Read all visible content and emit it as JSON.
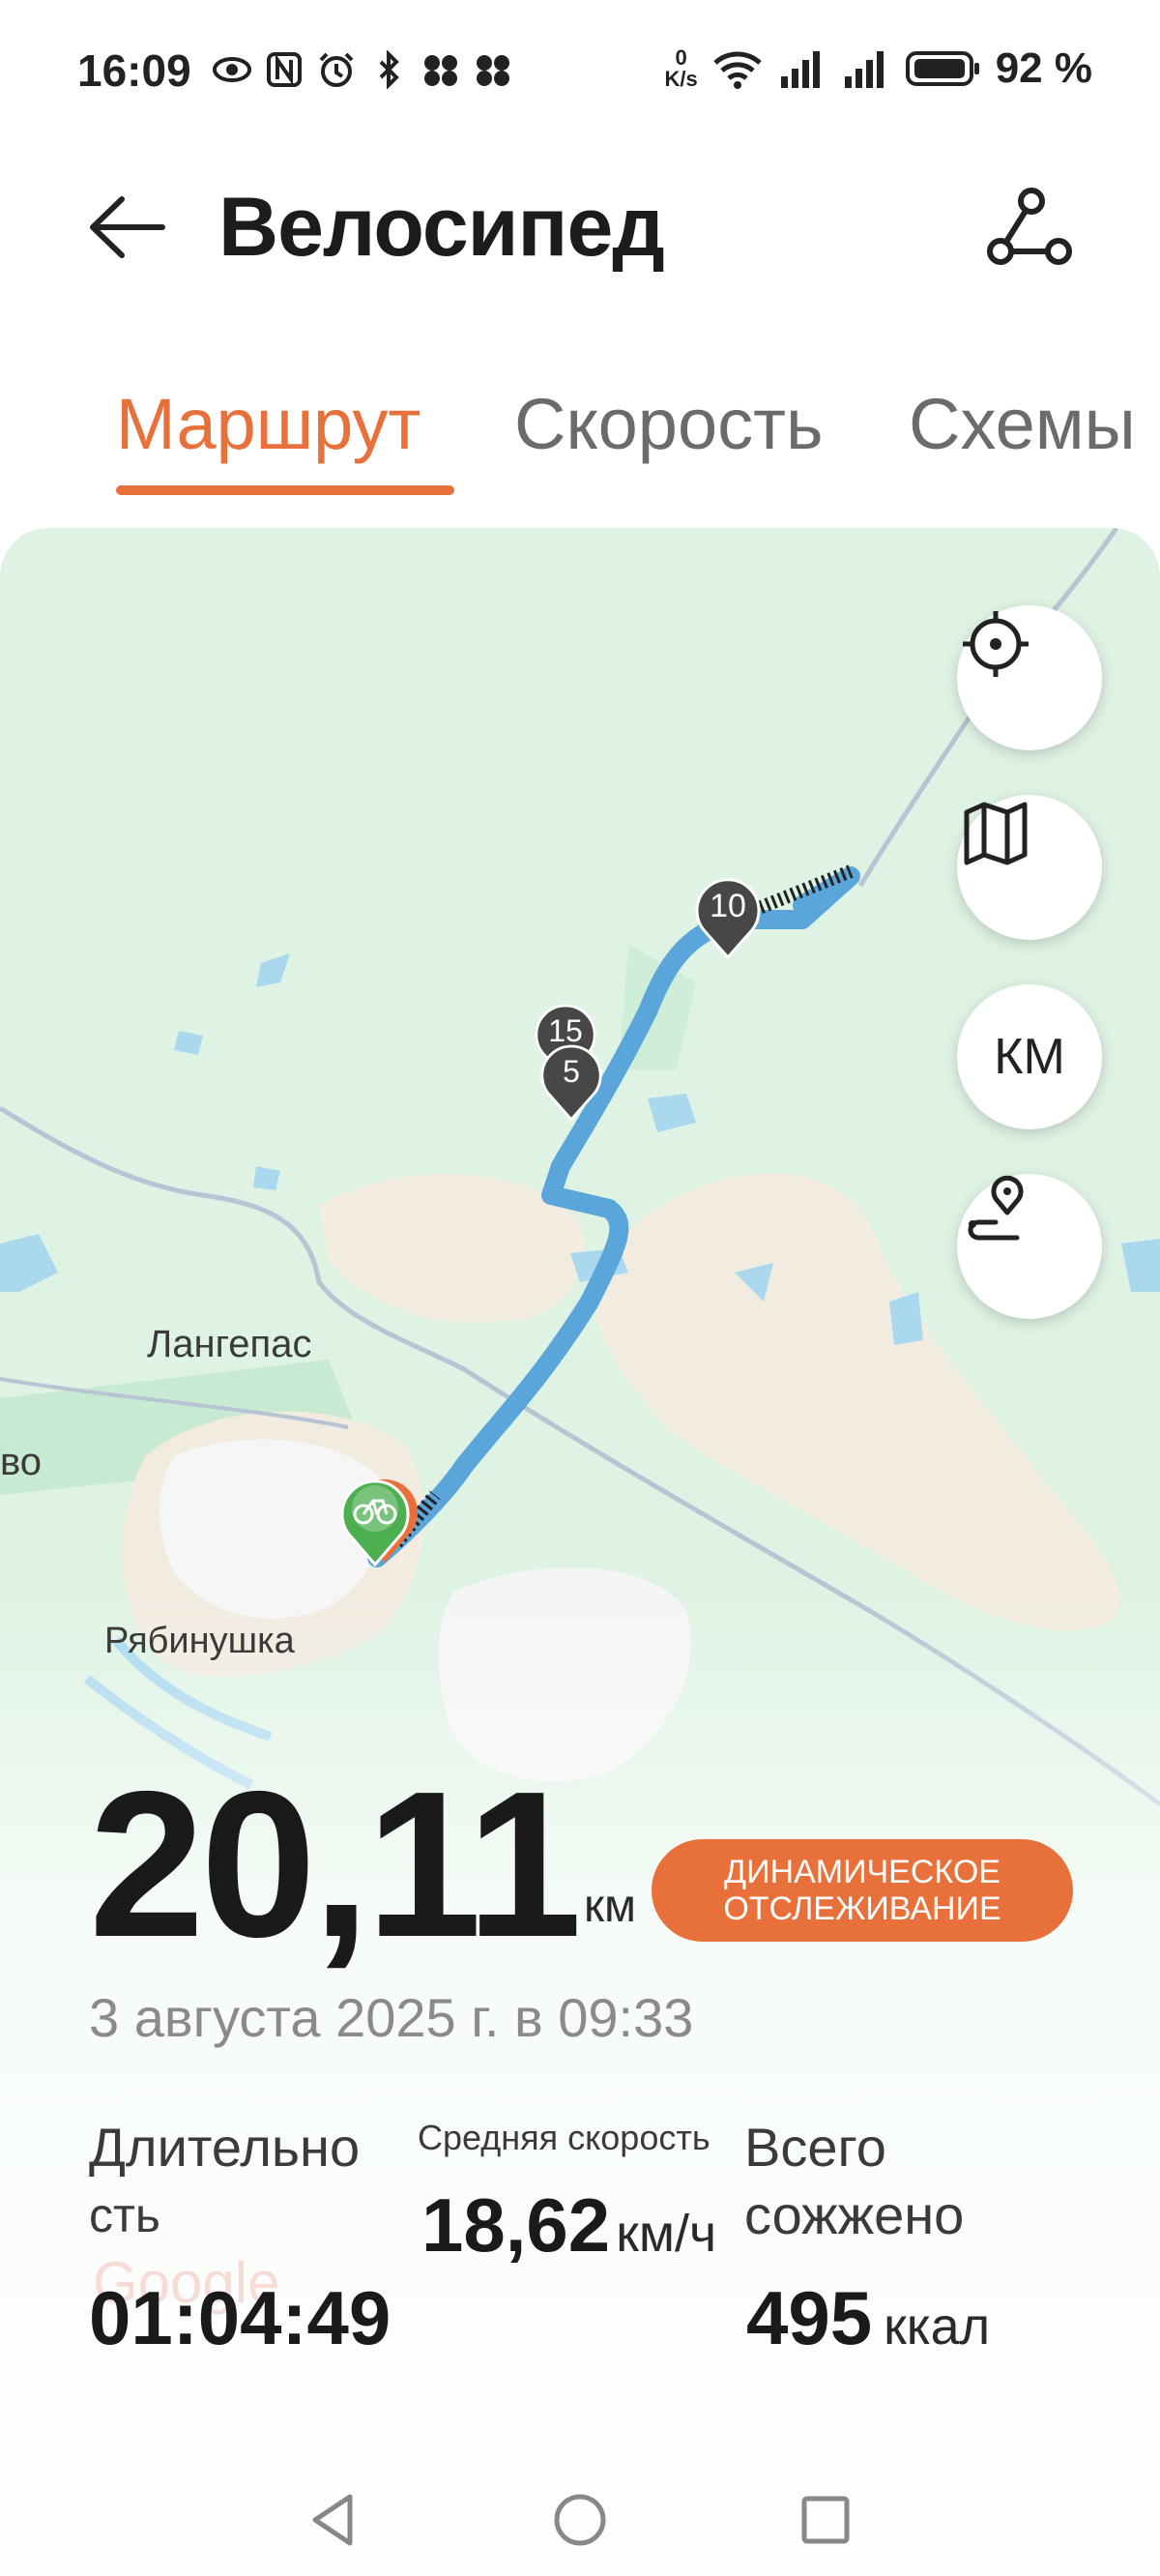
{
  "status_bar": {
    "time": "16:09",
    "net_speed_value": "0",
    "net_speed_unit": "K/s",
    "battery": "92 %"
  },
  "header": {
    "title": "Велосипед"
  },
  "tabs": [
    {
      "label": "Маршрут",
      "active": true
    },
    {
      "label": "Скорость",
      "active": false
    },
    {
      "label": "Схемы",
      "active": false
    }
  ],
  "map": {
    "labels": {
      "city": "Лангепас",
      "village": "Рябинушка",
      "left_edge": "во"
    },
    "markers": [
      "10",
      "15",
      "5"
    ],
    "controls": {
      "km_label": "КМ"
    },
    "attribution": "Google"
  },
  "summary": {
    "distance": "20,11",
    "distance_unit": "км",
    "live_badge": "ДИНАМИЧЕСКОЕ ОТСЛЕЖИВАНИЕ",
    "date": "3 августа 2025 г. в 09:33"
  },
  "stats": {
    "duration": {
      "label_line1": "Длительно",
      "label_line2": "сть",
      "value": "01:04:49"
    },
    "avg_speed": {
      "label": "Средняя скорость",
      "value": "18,62",
      "unit": "км/ч"
    },
    "calories": {
      "label_line1": "Всего",
      "label_line2": "сожжено",
      "value": "495",
      "unit": "ккал"
    }
  },
  "colors": {
    "accent": "#e8703a",
    "route": "#5aa6db",
    "map_land": "#dff3e4",
    "map_sand": "#f2ece0"
  }
}
